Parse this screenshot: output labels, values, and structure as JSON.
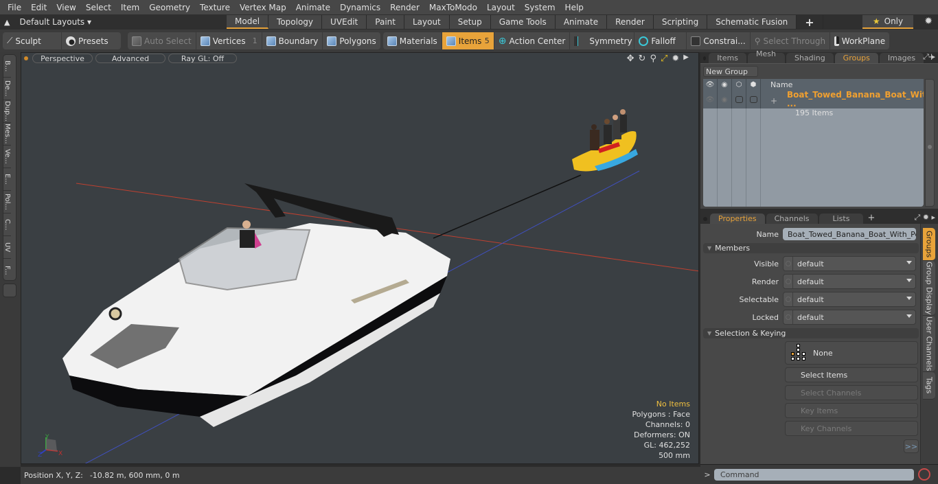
{
  "menubar": {
    "items": [
      "File",
      "Edit",
      "View",
      "Select",
      "Item",
      "Geometry",
      "Texture",
      "Vertex Map",
      "Animate",
      "Dynamics",
      "Render",
      "MaxToModo",
      "Layout",
      "System",
      "Help"
    ]
  },
  "layoutbar": {
    "layouts_label": "Default Layouts ▾",
    "tabs": [
      "Model",
      "Topology",
      "UVEdit",
      "Paint",
      "Layout",
      "Setup",
      "Game Tools",
      "Animate",
      "Render",
      "Scripting",
      "Schematic Fusion"
    ],
    "active_tab": "Model",
    "add_label": "+",
    "only_label": "Only"
  },
  "toolbar": {
    "sculpt": "Sculpt",
    "presets": "Presets",
    "auto_select": "Auto Select",
    "vertices": "Vertices",
    "vertices_count": "1",
    "boundary": "Boundary",
    "polygons": "Polygons",
    "materials": "Materials",
    "items": "Items",
    "items_count": "5",
    "action_center": "Action Center",
    "symmetry": "Symmetry",
    "falloff": "Falloff",
    "constraints": "Constrai...",
    "select_through": "Select Through",
    "workplane": "WorkPlane"
  },
  "left_tools": [
    "B...",
    "De...",
    "Dup...",
    "Mes...",
    "Ve...",
    "E...",
    "Pol...",
    "C...",
    "UV",
    "F..."
  ],
  "viewport": {
    "perspective": "Perspective",
    "advanced": "Advanced",
    "raygl": "Ray GL: Off",
    "hud": {
      "selection": "No Items",
      "polygons": "Polygons : Face",
      "channels": "Channels: 0",
      "deformers": "Deformers: ON",
      "gl": "GL: 462,252",
      "grid": "500 mm"
    },
    "axes": {
      "x": "X",
      "y": "Y",
      "z": "Z"
    }
  },
  "statusbar": {
    "label": "Position X, Y, Z:",
    "value": "-10.82 m, 600 mm, 0 m"
  },
  "groups_panel": {
    "tabs": [
      "Items",
      "Mesh ...",
      "Shading",
      "Groups",
      "Images"
    ],
    "active_tab": "Groups",
    "new_group": "New Group",
    "name_header": "Name",
    "rows": [
      {
        "name": "Boat_Towed_Banana_Boat_Wit ...",
        "count": "195 Items"
      }
    ]
  },
  "properties_panel": {
    "tabs": [
      "Properties",
      "Channels",
      "Lists"
    ],
    "active_tab": "Properties",
    "name_label": "Name",
    "name_value": "Boat_Towed_Banana_Boat_With_Peo",
    "members_section": "Members",
    "fields": [
      {
        "label": "Visible",
        "value": "default"
      },
      {
        "label": "Render",
        "value": "default"
      },
      {
        "label": "Selectable",
        "value": "default"
      },
      {
        "label": "Locked",
        "value": "default"
      }
    ],
    "selection_section": "Selection & Keying",
    "none_label": "None",
    "select_items": "Select Items",
    "select_channels": "Select Channels",
    "key_items": "Key Items",
    "key_channels": "Key Channels",
    "more": ">>",
    "side_tabs": [
      "Groups",
      "Group Display",
      "User Channels",
      "Tags"
    ],
    "active_side_tab": "Groups"
  },
  "command": {
    "prompt": ">",
    "placeholder": "Command"
  },
  "colors": {
    "accent": "#e8a33a",
    "viewport_bg": "#3a3f43",
    "x_axis": "#c04030",
    "z_axis": "#4050c0"
  }
}
